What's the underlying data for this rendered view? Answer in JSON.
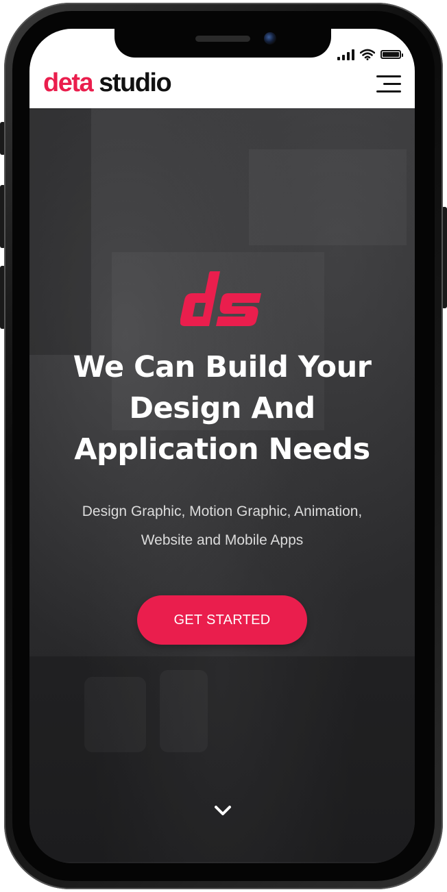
{
  "colors": {
    "brand": "#ea1e4d",
    "logo_dark": "#111111",
    "hero_text": "#ffffff",
    "hero_subtext": "#dcdcdc"
  },
  "status_bar": {
    "icons": [
      "signal-icon",
      "wifi-icon",
      "battery-icon"
    ],
    "battery_level": 1.0
  },
  "header": {
    "logo_word_1": "deta",
    "logo_word_2": "studio",
    "menu_icon": "hamburger-menu-icon"
  },
  "hero": {
    "mark_icon": "ds-logo-mark",
    "headline_lines": [
      "We Can Build Your",
      "Design And",
      "Application Needs"
    ],
    "subtext_lines": [
      "Design Graphic, Motion Graphic, Animation,",
      "Website and Mobile Apps"
    ],
    "cta_label": "GET STARTED",
    "scroll_icon": "chevron-down-icon"
  }
}
